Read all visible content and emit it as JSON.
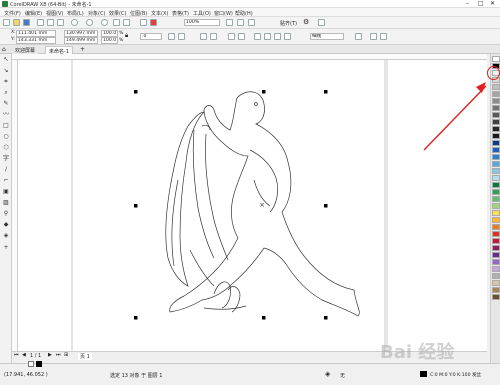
{
  "window": {
    "title": "CorelDRAW X8 (64-Bit) - 未命名-1"
  },
  "menu": [
    "文件(F)",
    "编辑(E)",
    "视图(V)",
    "布局(L)",
    "对象(C)",
    "效果(C)",
    "位图(B)",
    "文本(X)",
    "表格(T)",
    "工具(O)",
    "窗口(W)",
    "帮助(H)"
  ],
  "toolbar": {
    "zoom": "100%",
    "snap_label": "贴齐(T)",
    "x_value": "111.401 mm",
    "y_value": "143.331 mm",
    "w_value": "130.997 mm",
    "h_value": "149.499 mm",
    "scale_x": "100.0",
    "scale_y": "100.0",
    "pct": "%",
    "angle": ".0",
    "outline_width": "细线"
  },
  "tabs": {
    "welcome": "欢迎屏幕",
    "document": "未命名-1"
  },
  "pagebar": {
    "counter": "1 / 1",
    "page_tab": "页 1"
  },
  "status": {
    "coords": "(17.941, 46.052 )",
    "selection": "选定 13 对象 于 图层 1",
    "fill_label": "无",
    "outline_label": "C:0 M:0 Y:0 K:100 发丝"
  },
  "watermark": "Bai 经验",
  "colors": {
    "accent": "#e02020",
    "palette": [
      "#ffffff",
      "#000000",
      "#f2f2f2",
      "#d9d9d9",
      "#bfbfbf",
      "#a6a6a6",
      "#8c8c8c",
      "#737373",
      "#595959",
      "#404040",
      "#262626",
      "#1a1a1a",
      "#0b3c8c",
      "#1f5fbf",
      "#2b7dd6",
      "#55a8e0",
      "#8ac6ea",
      "#b7dcef",
      "#0a7a3a",
      "#2ea34f",
      "#5cc16a",
      "#9fd67a",
      "#ffe14d",
      "#ffb52e",
      "#f07a1e",
      "#e0301e",
      "#c21b3a",
      "#8f1a5c",
      "#6a2b8c",
      "#9467c5",
      "#c7a6e0",
      "#b0b0b0",
      "#d8c6a8",
      "#a8855a",
      "#6e4f2f"
    ]
  }
}
